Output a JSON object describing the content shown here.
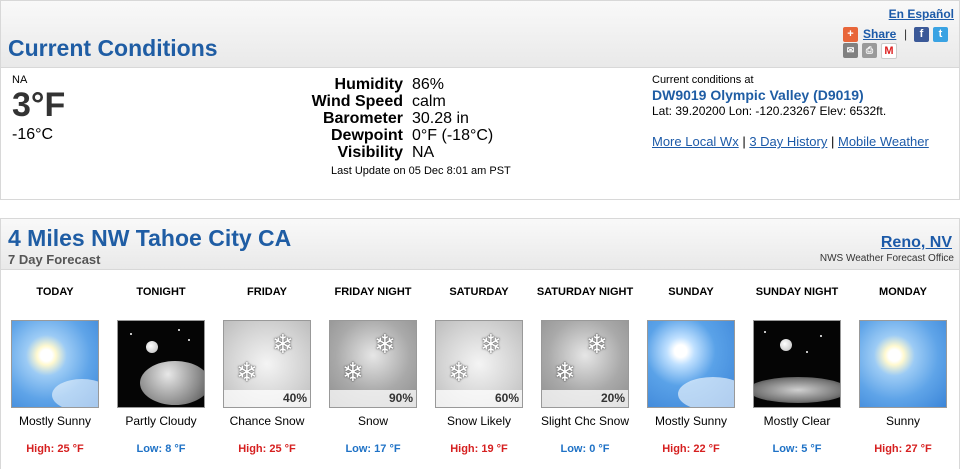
{
  "header": {
    "title": "Current Conditions",
    "espanol": "En Español",
    "share_label": "Share"
  },
  "current": {
    "condition": "NA",
    "temp_f": "3°F",
    "temp_c": "-16°C",
    "details": [
      {
        "label": "Humidity",
        "value": "86%"
      },
      {
        "label": "Wind Speed",
        "value": "calm"
      },
      {
        "label": "Barometer",
        "value": "30.28 in"
      },
      {
        "label": "Dewpoint",
        "value": "0°F (-18°C)"
      },
      {
        "label": "Visibility",
        "value": "NA"
      }
    ],
    "last_update": "Last Update on 05 Dec 8:01 am PST"
  },
  "station": {
    "intro": "Current conditions at",
    "name": "DW9019 Olympic Valley (D9019)",
    "latlon": "Lat: 39.20200 Lon: -120.23267 Elev: 6532ft.",
    "links": [
      "More Local Wx",
      "3 Day History",
      "Mobile Weather"
    ]
  },
  "forecast": {
    "title": "4 Miles NW Tahoe City CA",
    "subtitle": "7 Day Forecast",
    "office": "Reno, NV",
    "office_label": "NWS Weather Forecast Office",
    "periods": [
      {
        "name": "TODAY",
        "icon": "sunny-icon",
        "pop": "",
        "desc": "Mostly Sunny",
        "temp": "High: 25 °F",
        "kind": "hi"
      },
      {
        "name": "TONIGHT",
        "icon": "partly-cloudy-night-icon",
        "pop": "",
        "desc": "Partly Cloudy",
        "temp": "Low: 8 °F",
        "kind": "lo"
      },
      {
        "name": "FRIDAY",
        "icon": "chance-snow-icon",
        "pop": "40%",
        "desc": "Chance Snow",
        "temp": "High: 25 °F",
        "kind": "hi"
      },
      {
        "name": "FRIDAY NIGHT",
        "icon": "snow-icon",
        "pop": "90%",
        "desc": "Snow",
        "temp": "Low: 17 °F",
        "kind": "lo"
      },
      {
        "name": "SATURDAY",
        "icon": "snow-likely-icon",
        "pop": "60%",
        "desc": "Snow Likely",
        "temp": "High: 19 °F",
        "kind": "hi"
      },
      {
        "name": "SATURDAY NIGHT",
        "icon": "slight-chance-snow-icon",
        "pop": "20%",
        "desc": "Slight Chc Snow",
        "temp": "Low: 0 °F",
        "kind": "lo"
      },
      {
        "name": "SUNDAY",
        "icon": "mostly-sunny-icon",
        "pop": "",
        "desc": "Mostly Sunny",
        "temp": "High: 22 °F",
        "kind": "hi"
      },
      {
        "name": "SUNDAY NIGHT",
        "icon": "mostly-clear-night-icon",
        "pop": "",
        "desc": "Mostly Clear",
        "temp": "Low: 5 °F",
        "kind": "lo"
      },
      {
        "name": "MONDAY",
        "icon": "sunny-icon",
        "pop": "",
        "desc": "Sunny",
        "temp": "High: 27 °F",
        "kind": "hi"
      }
    ]
  },
  "colors": {
    "title": "#1f5da4",
    "high": "#d62020",
    "low": "#1f72c6"
  }
}
